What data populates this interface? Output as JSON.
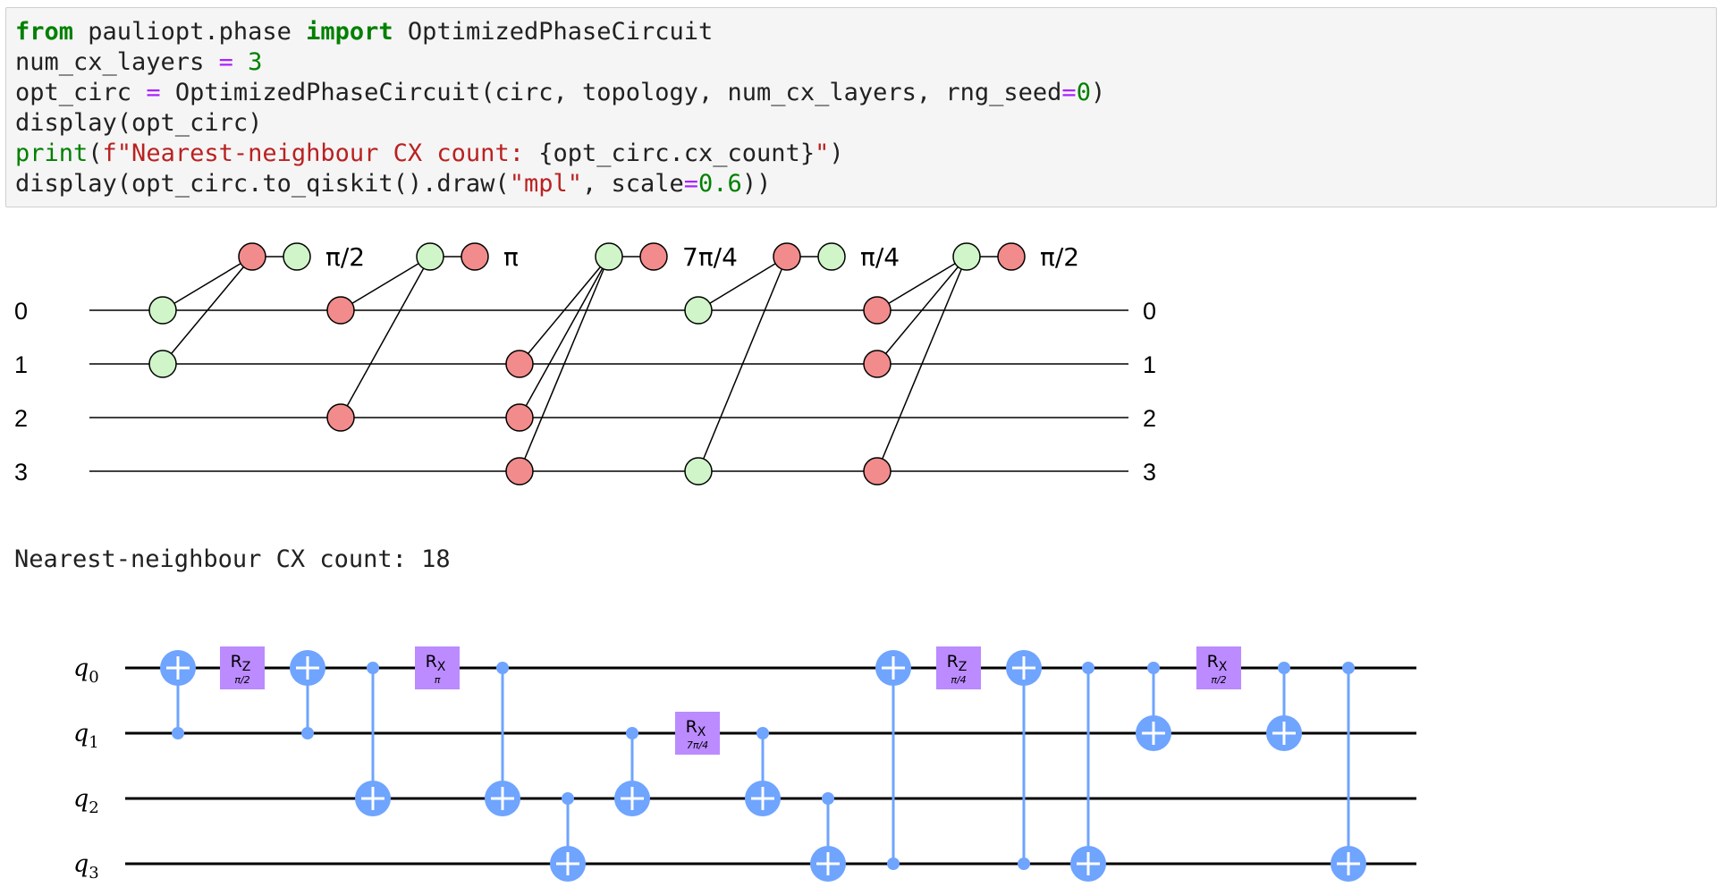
{
  "code_cell": {
    "lines": [
      [
        {
          "t": "from",
          "c": "kw"
        },
        {
          "t": " pauliopt.phase ",
          "c": ""
        },
        {
          "t": "import",
          "c": "kw"
        },
        {
          "t": " OptimizedPhaseCircuit",
          "c": ""
        }
      ],
      [
        {
          "t": "num_cx_layers ",
          "c": ""
        },
        {
          "t": "=",
          "c": "op"
        },
        {
          "t": " ",
          "c": ""
        },
        {
          "t": "3",
          "c": "num"
        }
      ],
      [
        {
          "t": "opt_circ ",
          "c": ""
        },
        {
          "t": "=",
          "c": "op"
        },
        {
          "t": " OptimizedPhaseCircuit(circ, topology, num_cx_layers, rng_seed",
          "c": ""
        },
        {
          "t": "=",
          "c": "op"
        },
        {
          "t": "0",
          "c": "num"
        },
        {
          "t": ")",
          "c": ""
        }
      ],
      [
        {
          "t": "display(opt_circ)",
          "c": ""
        }
      ],
      [
        {
          "t": "print",
          "c": "bi"
        },
        {
          "t": "(",
          "c": ""
        },
        {
          "t": "f\"Nearest-neighbour CX count: ",
          "c": "str"
        },
        {
          "t": "{opt_circ.cx_count}",
          "c": ""
        },
        {
          "t": "\"",
          "c": "str"
        },
        {
          "t": ")",
          "c": ""
        }
      ],
      [
        {
          "t": "display(opt_circ.to_qiskit().draw(",
          "c": ""
        },
        {
          "t": "\"mpl\"",
          "c": "str"
        },
        {
          "t": ", scale",
          "c": ""
        },
        {
          "t": "=",
          "c": "op"
        },
        {
          "t": "0.6",
          "c": "num"
        },
        {
          "t": "))",
          "c": ""
        }
      ]
    ]
  },
  "phase_circuit": {
    "qubit_labels": [
      "0",
      "1",
      "2",
      "3"
    ],
    "colors": {
      "z": "#f28b8b",
      "x": "#cff5c8",
      "stroke": "#000000"
    },
    "gadgets": [
      {
        "angle": "π/2",
        "hub": "z",
        "leg": "x",
        "legs_qubits": [
          0,
          1
        ]
      },
      {
        "angle": "π",
        "hub": "x",
        "leg": "z",
        "legs_qubits": [
          0,
          2
        ]
      },
      {
        "angle": "7π/4",
        "hub": "x",
        "leg": "z",
        "legs_qubits": [
          1,
          2,
          3
        ]
      },
      {
        "angle": "π/4",
        "hub": "z",
        "leg": "x",
        "legs_qubits": [
          0,
          3
        ]
      },
      {
        "angle": "π/2",
        "hub": "x",
        "leg": "z",
        "legs_qubits": [
          0,
          1,
          3
        ]
      }
    ]
  },
  "output_text": "Nearest-neighbour CX count: 18",
  "qiskit_circuit": {
    "qubit_labels": [
      {
        "base": "q",
        "sub": "0"
      },
      {
        "base": "q",
        "sub": "1"
      },
      {
        "base": "q",
        "sub": "2"
      },
      {
        "base": "q",
        "sub": "3"
      }
    ],
    "colors": {
      "cx": "#6fa4ff",
      "rot": "#bb8bff",
      "wire": "#000000"
    },
    "gates": [
      {
        "type": "cx",
        "control": 1,
        "target": 0
      },
      {
        "type": "rot",
        "axis": "Z",
        "qubit": 0,
        "param": "π/2"
      },
      {
        "type": "cx",
        "control": 1,
        "target": 0
      },
      {
        "type": "cx",
        "control": 0,
        "target": 2
      },
      {
        "type": "rot",
        "axis": "X",
        "qubit": 0,
        "param": "π"
      },
      {
        "type": "cx",
        "control": 0,
        "target": 2
      },
      {
        "type": "cx",
        "control": 2,
        "target": 3
      },
      {
        "type": "cx",
        "control": 1,
        "target": 2
      },
      {
        "type": "rot",
        "axis": "X",
        "qubit": 1,
        "param": "7π/4"
      },
      {
        "type": "cx",
        "control": 1,
        "target": 2
      },
      {
        "type": "cx",
        "control": 2,
        "target": 3
      },
      {
        "type": "cx",
        "control": 3,
        "target": 0
      },
      {
        "type": "rot",
        "axis": "Z",
        "qubit": 0,
        "param": "π/4"
      },
      {
        "type": "cx",
        "control": 3,
        "target": 0
      },
      {
        "type": "cx",
        "control": 0,
        "target": 3
      },
      {
        "type": "cx",
        "control": 0,
        "target": 1
      },
      {
        "type": "rot",
        "axis": "X",
        "qubit": 0,
        "param": "π/2"
      },
      {
        "type": "cx",
        "control": 0,
        "target": 1
      },
      {
        "type": "cx",
        "control": 0,
        "target": 3
      }
    ]
  }
}
